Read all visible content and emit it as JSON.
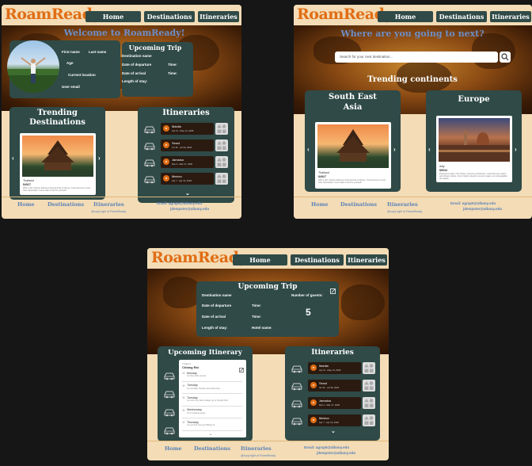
{
  "nav": {
    "logo": "RoamReady",
    "home": "Home",
    "destinations": "Destinations",
    "itineraries": "Itineraries"
  },
  "footer": {
    "home": "Home",
    "destinations": "Destinations",
    "itineraries": "Itineraries",
    "copyright": "@copy right of RoamReady",
    "email_label": "Email: agrap5@albany.edu",
    "email_2": "jdempster@albany.edu"
  },
  "profile": {
    "welcome": "Welcome to RoamReady!",
    "first_name": "First name",
    "last_name": "Last name",
    "age": "Age",
    "current_location": "Current location",
    "user_email": "User email"
  },
  "upcoming_trip": {
    "title": "Upcoming Trip",
    "destination_name": "Destination name",
    "date_departure": "Date of departure",
    "date_arrival": "Date of arrival",
    "length_stay": "Length of stay:",
    "time": "Time:",
    "hotel_name": "Hotel name:",
    "guests_label": "Number of guests:",
    "guests_value": "5"
  },
  "trending": {
    "title": "Trending Destinations",
    "card_name": "Thailand",
    "card_price": "$4927",
    "card_desc": "With a rich cultural, delicious food and lots of things, it has become a must have destination. Come take a look for yourself!"
  },
  "itineraries": {
    "title": "Itineraries",
    "rows": [
      {
        "name": "Manila",
        "dates": "Apr 11 - May 13, 2026"
      },
      {
        "name": "Seoul",
        "dates": "Jul 16 - Jul 30, 2026"
      },
      {
        "name": "Jamaica",
        "dates": "Mar 4 - Mar 17, 2026"
      },
      {
        "name": "Mexico",
        "dates": "Apr 7 - Apr 19, 2026"
      }
    ]
  },
  "search": {
    "heading": "Where are you going to next?",
    "placeholder": "Search for your next destination..."
  },
  "continents": {
    "title": "Trending continents",
    "sea": {
      "title": "South East Asia",
      "card_name": "Thailand",
      "card_price": "$4927",
      "card_desc": "With a rich cultural, delicious food and lots of things, it has become a must have destination. Come take a look for yourself!"
    },
    "europe": {
      "title": "Europe",
      "card_name": "Italy",
      "card_price": "$5034",
      "card_desc": "Experience Italy's rich history, stunning architecture, world famous cuisine and vibrant culture. From historic streets to scenic coasts, an unforgettable trip awaits."
    }
  },
  "upcoming_itinerary": {
    "title": "Upcoming Itinerary",
    "country": "Thailand",
    "city": "Chiang Rai",
    "days": [
      {
        "day": "Monday",
        "note": "Go hike white temple"
      },
      {
        "day": "Tuesday",
        "note": "Go visit Blue Temple and Lalita Cafe"
      },
      {
        "day": "Tuesday",
        "note": "Go visit Long Neck village, go to Singha Park"
      },
      {
        "day": "Wednesday",
        "note": "Go to trekking areas"
      },
      {
        "day": "Thursday",
        "note": "Go see Doi Tung and Bluely At"
      }
    ]
  },
  "colors": {
    "accent": "#e06d14",
    "panel": "#2f4a47",
    "cream": "#f3dcb6",
    "link": "#5b82b8"
  }
}
